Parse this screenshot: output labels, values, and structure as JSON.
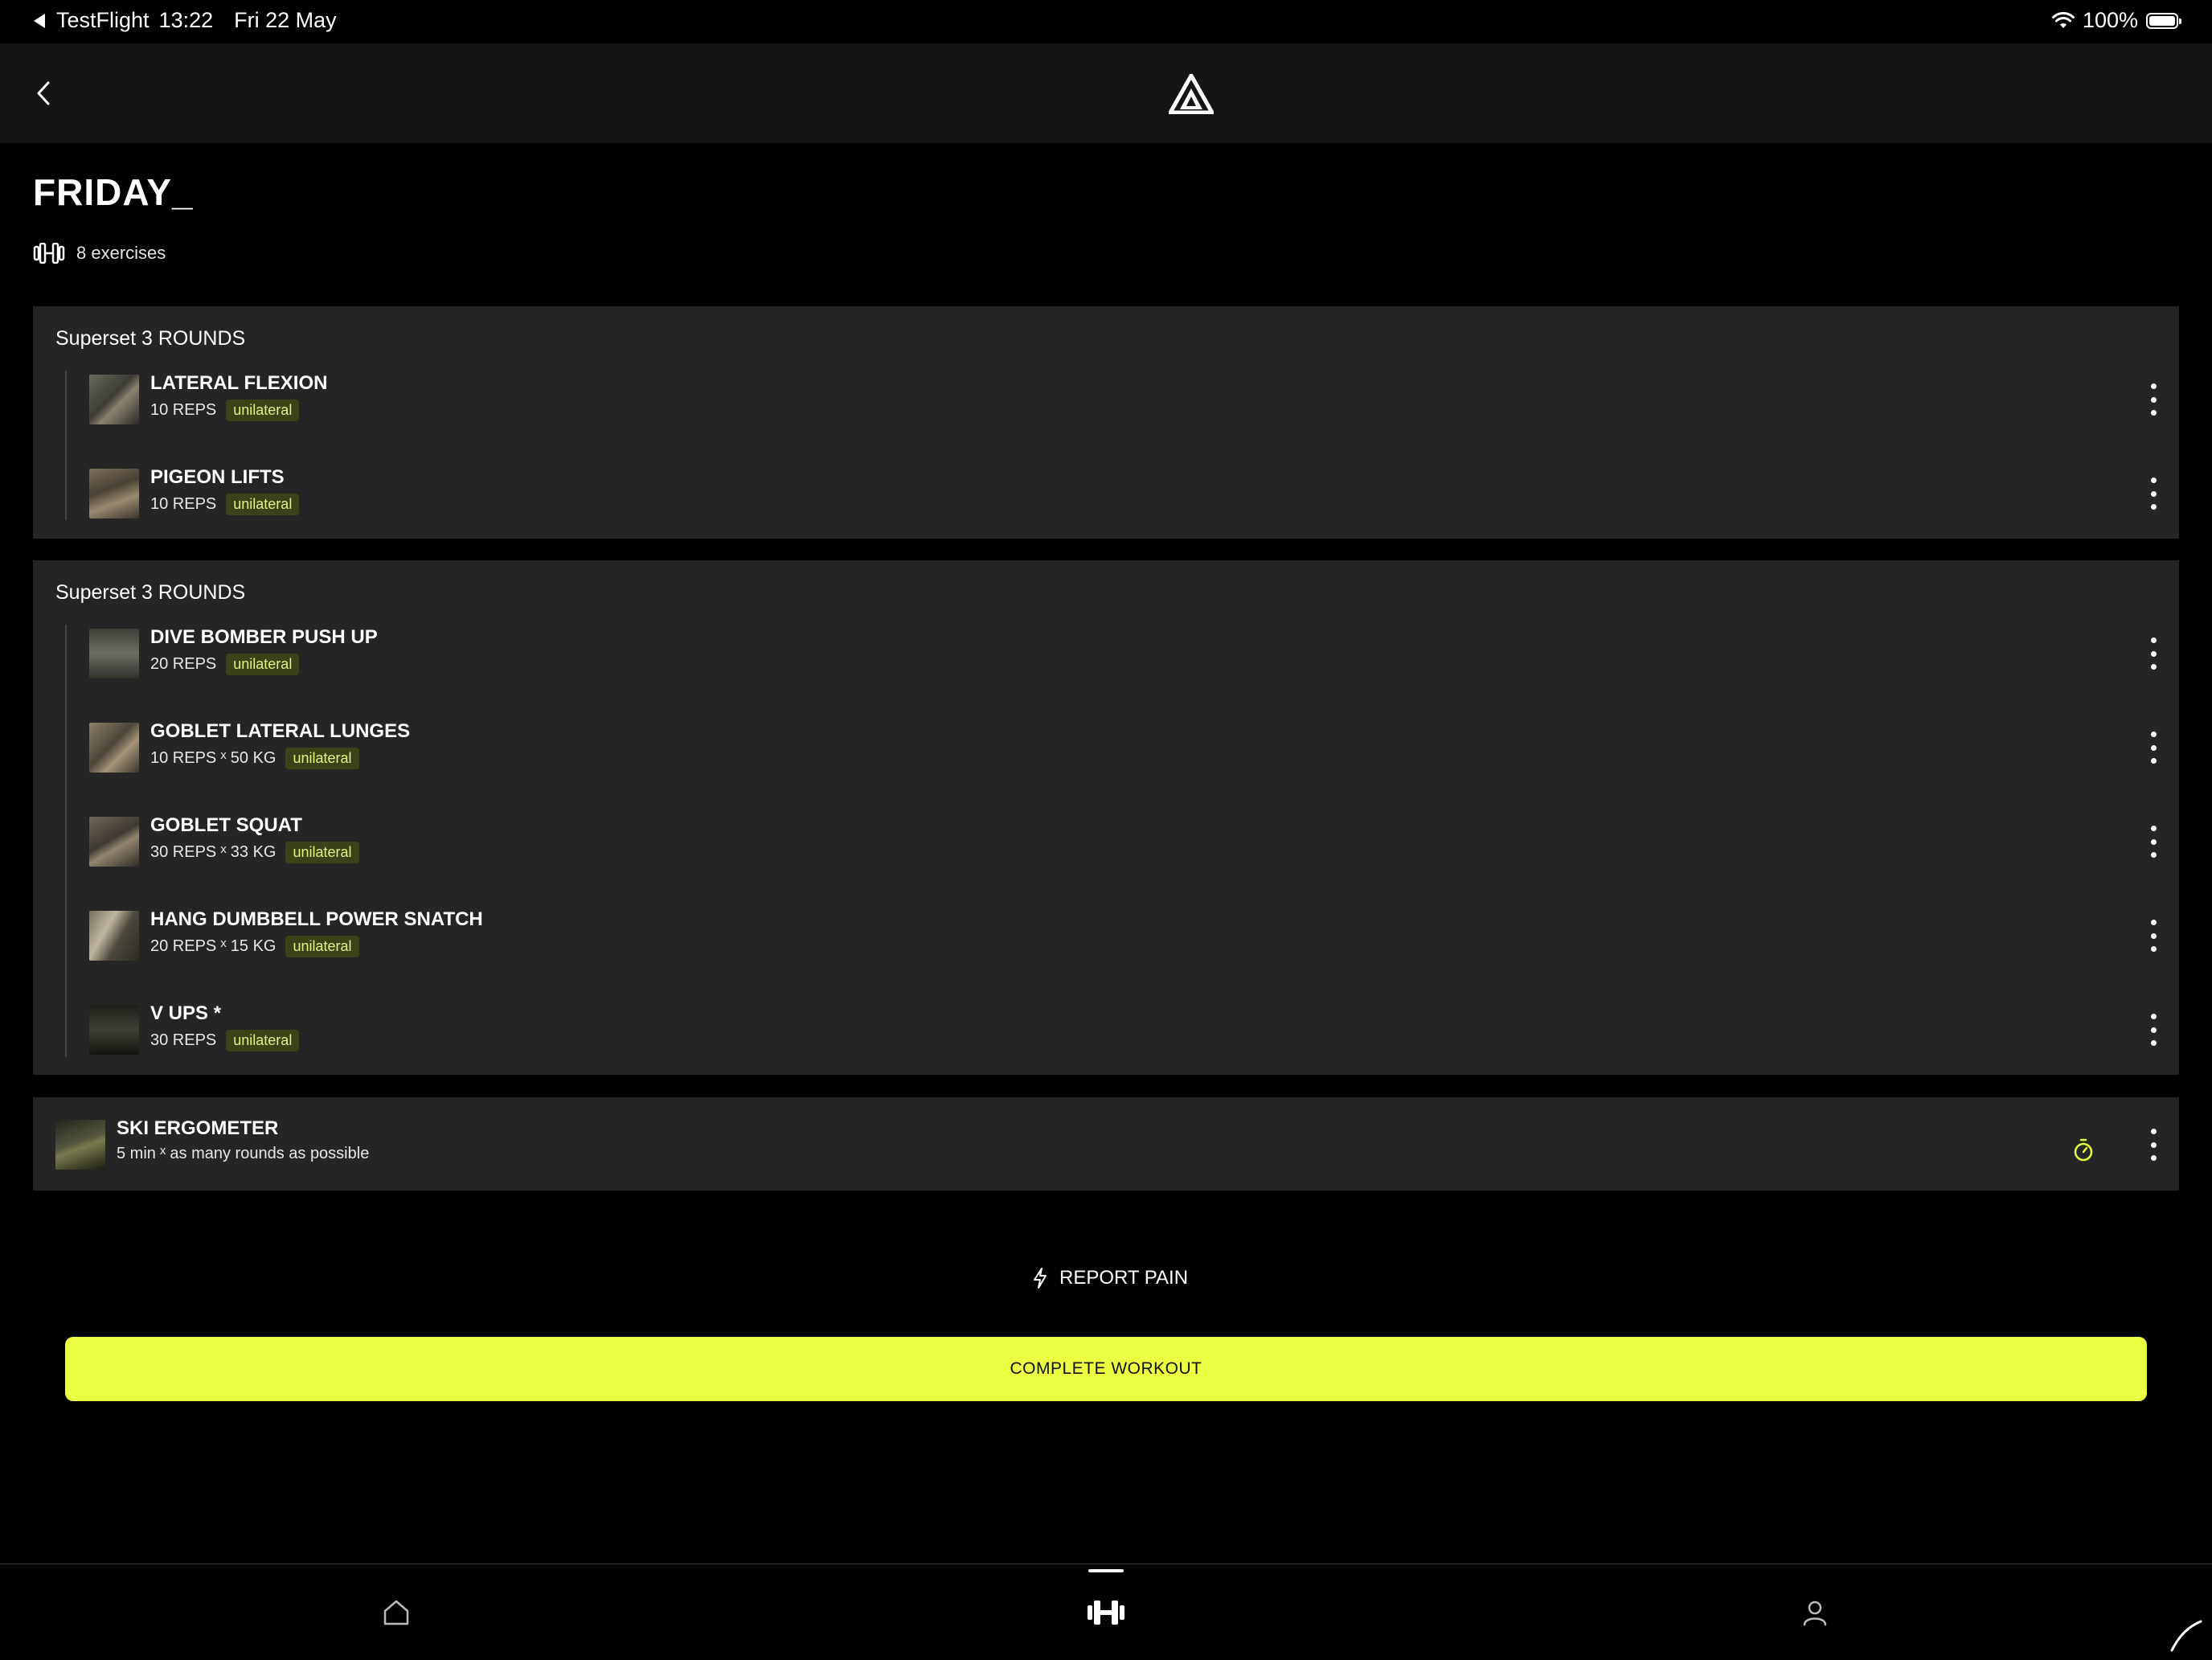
{
  "status_bar": {
    "back_app": "TestFlight",
    "time": "13:22",
    "date": "Fri 22 May",
    "battery": "100%"
  },
  "page": {
    "title": "FRIDAY_",
    "exercise_count": "8 exercises"
  },
  "groups": [
    {
      "title": "Superset 3 ROUNDS",
      "exercises": [
        {
          "name": "LATERAL FLEXION",
          "reps": "10 REPS",
          "weight": "",
          "tag": "unilateral"
        },
        {
          "name": "PIGEON LIFTS",
          "reps": "10 REPS",
          "weight": "",
          "tag": "unilateral"
        }
      ]
    },
    {
      "title": "Superset 3 ROUNDS",
      "exercises": [
        {
          "name": "DIVE BOMBER PUSH UP",
          "reps": "20 REPS",
          "weight": "",
          "tag": "unilateral"
        },
        {
          "name": "GOBLET LATERAL LUNGES",
          "reps": "10 REPS",
          "weight": "50 KG",
          "tag": "unilateral"
        },
        {
          "name": "GOBLET SQUAT",
          "reps": "30 REPS",
          "weight": "33 KG",
          "tag": "unilateral"
        },
        {
          "name": "HANG DUMBBELL POWER SNATCH",
          "reps": "20 REPS",
          "weight": "15 KG",
          "tag": "unilateral"
        },
        {
          "name": "V UPS *",
          "reps": "30 REPS",
          "weight": "",
          "tag": "unilateral"
        }
      ]
    }
  ],
  "single_exercise": {
    "name": "SKI ERGOMETER",
    "duration": "5 min",
    "detail": "as many rounds as possible"
  },
  "multiplier": "x",
  "actions": {
    "report_pain": "REPORT PAIN",
    "complete_workout": "COMPLETE WORKOUT"
  },
  "tabs": [
    {
      "icon": "home-icon"
    },
    {
      "icon": "dumbbell-icon",
      "active": true
    },
    {
      "icon": "profile-icon"
    }
  ],
  "colors": {
    "accent": "#eaff42",
    "tag_bg": "#3a4318",
    "card_bg": "#252525",
    "header_bg": "#151515"
  }
}
